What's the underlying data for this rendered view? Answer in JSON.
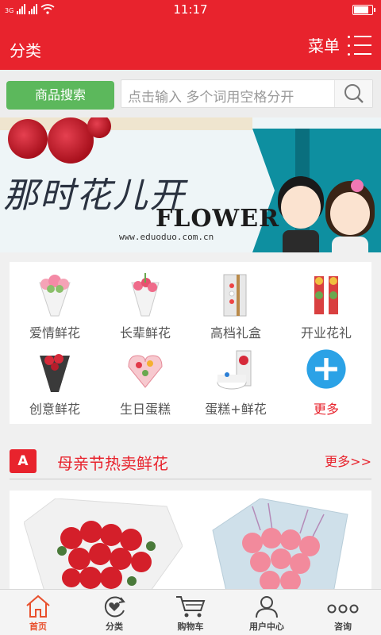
{
  "status_bar": {
    "network": "3G",
    "time": "11:17",
    "battery_level": 0.85
  },
  "header": {
    "title": "分类",
    "menu_label": "菜单"
  },
  "search": {
    "button_label": "商品搜索",
    "placeholder": "点击输入 多个词用空格分开"
  },
  "banner": {
    "title_cn": "那时花儿开",
    "title_en": "FLOWER",
    "url": "www.eduoduo.com.cn"
  },
  "categories": [
    {
      "label": "爱情鲜花",
      "icon": "bouquet-pink-icon"
    },
    {
      "label": "长辈鲜花",
      "icon": "bouquet-carnation-icon"
    },
    {
      "label": "高档礼盒",
      "icon": "gift-box-icon"
    },
    {
      "label": "开业花礼",
      "icon": "flower-basket-icon"
    },
    {
      "label": "创意鲜花",
      "icon": "bouquet-dark-icon"
    },
    {
      "label": "生日蛋糕",
      "icon": "birthday-cake-icon"
    },
    {
      "label": "蛋糕+鲜花",
      "icon": "cake-flower-icon"
    },
    {
      "label": "更多",
      "icon": "plus-icon"
    }
  ],
  "section": {
    "badge": "A",
    "title": "母亲节热卖鲜花",
    "more": "更多>>"
  },
  "bottom_nav": [
    {
      "label": "首页",
      "icon": "home-icon",
      "active": true
    },
    {
      "label": "分类",
      "icon": "category-heart-icon",
      "active": false
    },
    {
      "label": "购物车",
      "icon": "cart-icon",
      "active": false
    },
    {
      "label": "用户中心",
      "icon": "user-icon",
      "active": false
    },
    {
      "label": "咨询",
      "icon": "more-dots-icon",
      "active": false
    }
  ],
  "colors": {
    "primary": "#e8232d",
    "search_button": "#5cb85c",
    "nav_active": "#e8502d",
    "more_blue": "#2ba2e6"
  }
}
